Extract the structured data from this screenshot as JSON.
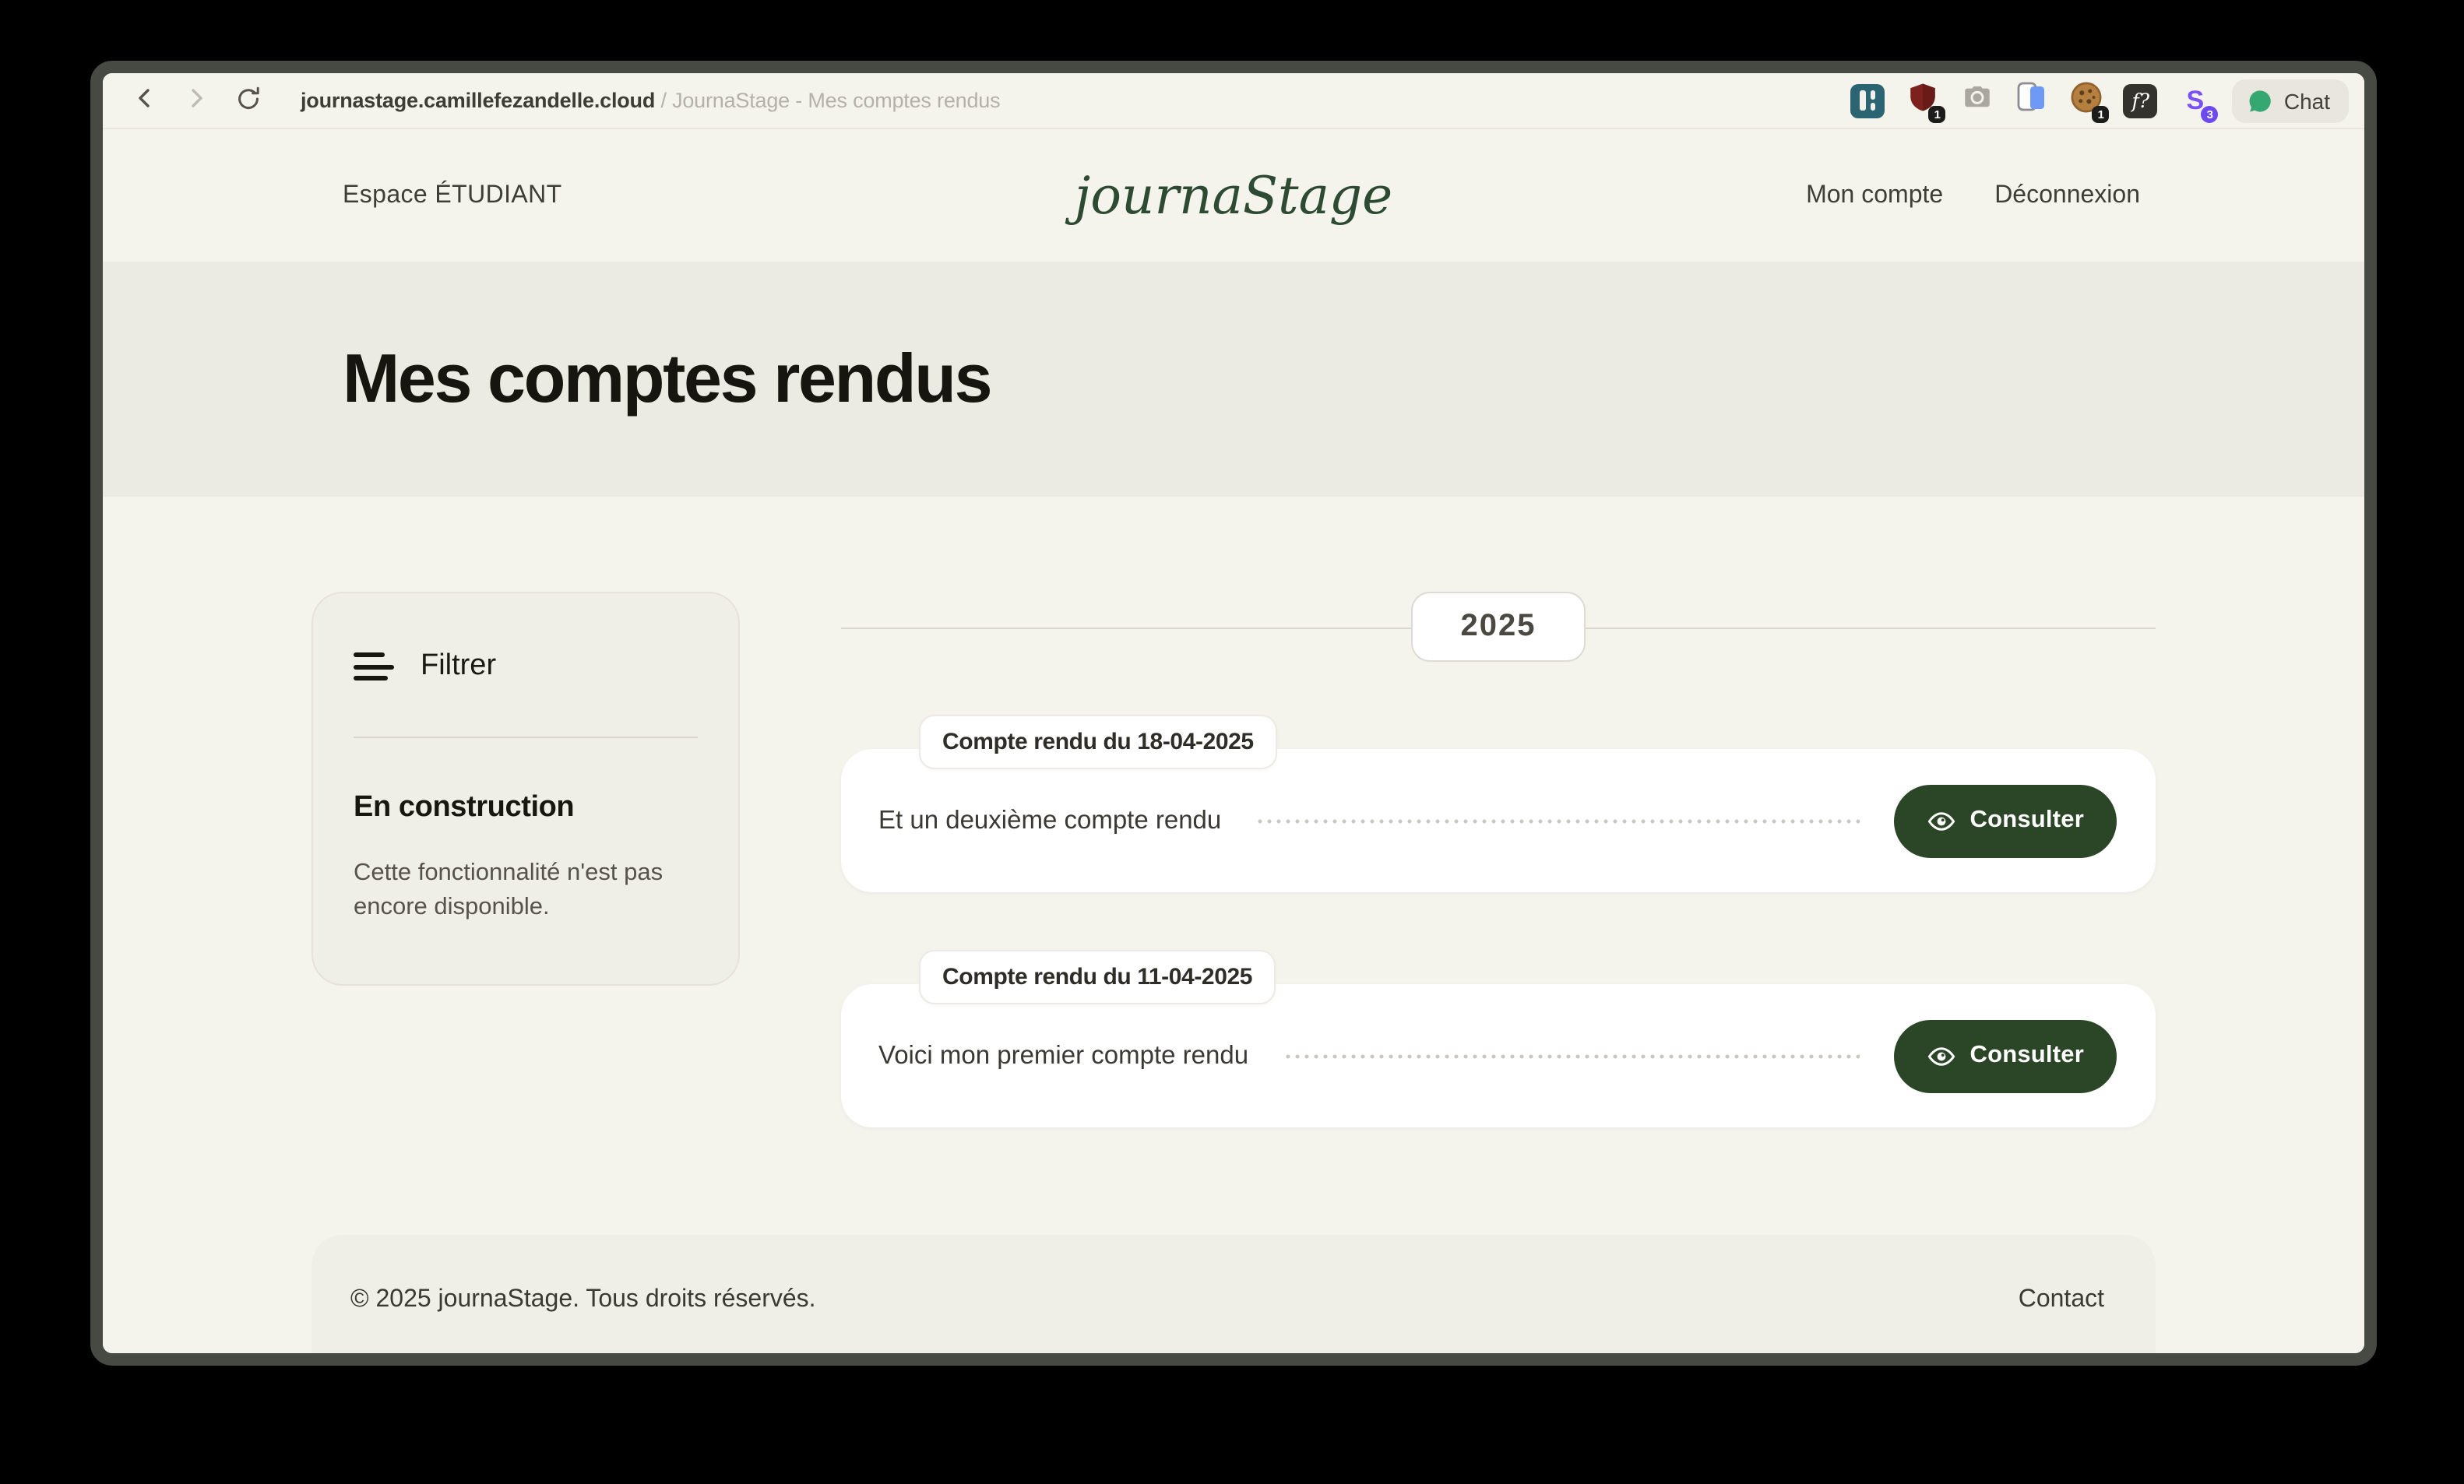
{
  "browser": {
    "url_domain": "journastage.camillefezandelle.cloud",
    "url_separator": " / ",
    "page_title": "JournaStage - Mes comptes rendus",
    "chat_label": "Chat",
    "extensions": [
      {
        "icon": "equalizer-extension-icon",
        "badge": ""
      },
      {
        "icon": "shield-adblock-icon",
        "badge": "1"
      },
      {
        "icon": "camera-extension-icon",
        "badge": ""
      },
      {
        "icon": "mobile-view-extension-icon",
        "badge": ""
      },
      {
        "icon": "cookie-extension-icon",
        "badge": "1"
      },
      {
        "icon": "font-finder-extension-icon",
        "glyph": "f?",
        "badge": ""
      },
      {
        "icon": "stylus-extension-icon",
        "glyph": "S",
        "badge": "3"
      }
    ]
  },
  "header": {
    "space_label": "Espace ÉTUDIANT",
    "logo": "journaStage",
    "nav": [
      {
        "label": "Mon compte"
      },
      {
        "label": "Déconnexion"
      }
    ]
  },
  "page": {
    "title": "Mes comptes rendus"
  },
  "filter": {
    "title": "Filtrer",
    "status_heading": "En construction",
    "status_text": "Cette fonctionnalité n'est pas encore disponible."
  },
  "timeline": {
    "year": "2025",
    "reports": [
      {
        "label": "Compte rendu du 18-04-2025",
        "text": "Et un deuxième compte rendu",
        "action": "Consulter"
      },
      {
        "label": "Compte rendu du 11-04-2025",
        "text": "Voici mon premier compte rendu",
        "action": "Consulter"
      }
    ]
  },
  "footer": {
    "copyright": "© 2025 journaStage. Tous droits réservés.",
    "contact": "Contact"
  },
  "colors": {
    "brand_green": "#2B4627",
    "logo_green": "#2D4B32",
    "page_bg": "#F4F3EC",
    "band_bg": "#ECEBE3",
    "panel_bg": "#EFEEE7",
    "window_border": "#464A43",
    "chat_green": "#35A770"
  }
}
